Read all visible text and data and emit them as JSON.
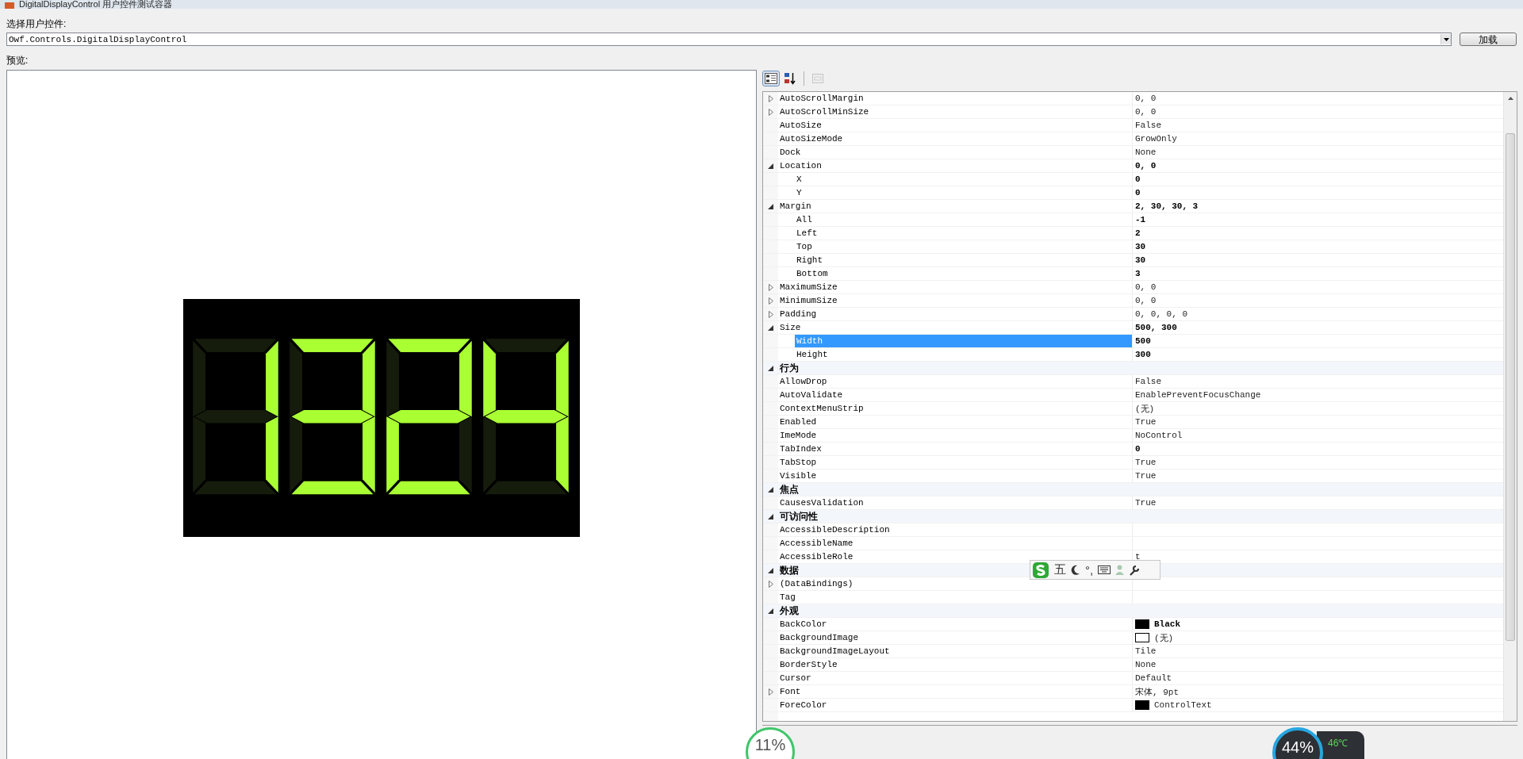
{
  "window": {
    "title": "DigitalDisplayControl 用户控件测试容器"
  },
  "control_picker": {
    "label": "选择用户控件:",
    "value": "Owf.Controls.DigitalDisplayControl",
    "load_button": "加载"
  },
  "preview": {
    "label": "预览:",
    "display": {
      "digits": [
        {
          "segments": [
            false,
            true,
            true,
            false,
            false,
            false,
            false
          ]
        },
        {
          "segments": [
            true,
            true,
            true,
            true,
            false,
            false,
            true
          ]
        },
        {
          "segments": [
            true,
            true,
            false,
            true,
            true,
            false,
            true
          ]
        },
        {
          "segments": [
            false,
            true,
            true,
            false,
            false,
            true,
            true
          ]
        }
      ]
    }
  },
  "toolbar": [
    {
      "kind": "categorized",
      "selected": true
    },
    {
      "kind": "alphabetical",
      "selected": false
    },
    {
      "kind": "pages",
      "disabled": true
    }
  ],
  "sections": [
    {
      "rows": [
        {
          "name": "AutoScrollMargin",
          "value": "0, 0",
          "modified": false,
          "selected": false,
          "expanded": false
        },
        {
          "name": "AutoScrollMinSize",
          "value": "0, 0",
          "modified": false,
          "selected": false,
          "expanded": false
        },
        {
          "name": "AutoSize",
          "value": "False",
          "modified": false,
          "selected": false
        },
        {
          "name": "AutoSizeMode",
          "value": "GrowOnly",
          "modified": false,
          "selected": false
        },
        {
          "name": "Dock",
          "value": "None",
          "modified": false,
          "selected": false
        },
        {
          "name": "Location",
          "value": "0, 0",
          "modified": true,
          "selected": false,
          "expanded": true,
          "children": [
            {
              "name": "X",
              "value": "0",
              "modified": true,
              "selected": false
            },
            {
              "name": "Y",
              "value": "0",
              "modified": true,
              "selected": false
            }
          ]
        },
        {
          "name": "Margin",
          "value": "2, 30, 30, 3",
          "modified": true,
          "selected": false,
          "expanded": true,
          "children": [
            {
              "name": "All",
              "value": "-1",
              "modified": true,
              "selected": false
            },
            {
              "name": "Left",
              "value": "2",
              "modified": true,
              "selected": false
            },
            {
              "name": "Top",
              "value": "30",
              "modified": true,
              "selected": false
            },
            {
              "name": "Right",
              "value": "30",
              "modified": true,
              "selected": false
            },
            {
              "name": "Bottom",
              "value": "3",
              "modified": true,
              "selected": false
            }
          ]
        },
        {
          "name": "MaximumSize",
          "value": "0, 0",
          "modified": false,
          "selected": false,
          "expanded": false
        },
        {
          "name": "MinimumSize",
          "value": "0, 0",
          "modified": false,
          "selected": false,
          "expanded": false
        },
        {
          "name": "Padding",
          "value": "0, 0, 0, 0",
          "modified": false,
          "selected": false,
          "expanded": false
        },
        {
          "name": "Size",
          "value": "500, 300",
          "modified": true,
          "selected": false,
          "expanded": true,
          "children": [
            {
              "name": "Width",
              "value": "500",
              "modified": true,
              "selected": true
            },
            {
              "name": "Height",
              "value": "300",
              "modified": true,
              "selected": false
            }
          ]
        }
      ]
    },
    {
      "title": "行为",
      "expanded": true,
      "rows": [
        {
          "name": "AllowDrop",
          "value": "False",
          "modified": false,
          "selected": false
        },
        {
          "name": "AutoValidate",
          "value": "EnablePreventFocusChange",
          "modified": false,
          "selected": false
        },
        {
          "name": "ContextMenuStrip",
          "value": "(无)",
          "modified": false,
          "selected": false
        },
        {
          "name": "Enabled",
          "value": "True",
          "modified": false,
          "selected": false
        },
        {
          "name": "ImeMode",
          "value": "NoControl",
          "modified": false,
          "selected": false
        },
        {
          "name": "TabIndex",
          "value": "0",
          "modified": true,
          "selected": false
        },
        {
          "name": "TabStop",
          "value": "True",
          "modified": false,
          "selected": false
        },
        {
          "name": "Visible",
          "value": "True",
          "modified": false,
          "selected": false
        }
      ]
    },
    {
      "title": "焦点",
      "expanded": true,
      "rows": [
        {
          "name": "CausesValidation",
          "value": "True",
          "modified": false,
          "selected": false
        }
      ]
    },
    {
      "title": "可访问性",
      "expanded": true,
      "rows": [
        {
          "name": "AccessibleDescription",
          "selected": false
        },
        {
          "name": "AccessibleName",
          "selected": false
        },
        {
          "name": "AccessibleRole",
          "value": "t",
          "modified": false,
          "selected": false
        }
      ]
    },
    {
      "title": "数据",
      "expanded": true,
      "rows": [
        {
          "name": "(DataBindings)",
          "selected": false,
          "expanded": false
        },
        {
          "name": "Tag",
          "selected": false
        }
      ]
    },
    {
      "title": "外观",
      "expanded": true,
      "rows": [
        {
          "name": "BackColor",
          "value": "Black",
          "color": "#000000",
          "modified": true,
          "selected": false
        },
        {
          "name": "BackgroundImage",
          "value": "(无)",
          "color": "#ffffff",
          "modified": false,
          "selected": false
        },
        {
          "name": "BackgroundImageLayout",
          "value": "Tile",
          "modified": false,
          "selected": false
        },
        {
          "name": "BorderStyle",
          "value": "None",
          "modified": false,
          "selected": false
        },
        {
          "name": "Cursor",
          "value": "Default",
          "modified": false,
          "selected": false
        },
        {
          "name": "Font",
          "value": "宋体, 9pt",
          "modified": false,
          "selected": false,
          "expanded": false
        },
        {
          "name": "ForeColor",
          "value": "ControlText",
          "color": "#000000",
          "modified": false,
          "selected": false
        }
      ]
    }
  ],
  "ime_bar": {
    "mode": "五",
    "punctuation": "°,"
  },
  "meters": [
    {
      "kind": "ring",
      "reading": "11%"
    },
    {
      "kind": "cpu",
      "reading": "44%",
      "temperature": "46℃"
    }
  ]
}
